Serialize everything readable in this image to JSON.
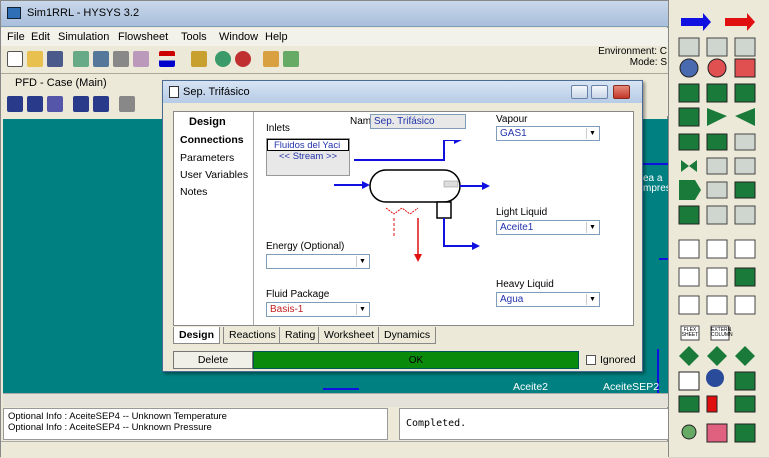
{
  "app": {
    "title": "Sim1RRL - HYSYS 3.2",
    "menu": [
      "File",
      "Edit",
      "Simulation",
      "Flowsheet",
      "Tools",
      "Window",
      "Help"
    ],
    "environment_text": "Environment: C",
    "mode_text": "Mode: S"
  },
  "pfd": {
    "title": "PFD - Case (Main)",
    "canvas_labels": [
      "ea a",
      "mpres",
      "Aceite2",
      "AceiteSEP2"
    ]
  },
  "dialog": {
    "title": "Sep. Trifásico",
    "nav_header": "Design",
    "nav_items": [
      "Connections",
      "Parameters",
      "User Variables",
      "Notes"
    ],
    "name_label": "Name",
    "name_value": "Sep. Trifásico",
    "inlets_label": "Inlets",
    "inlets": [
      "Fluidos del Yaci",
      "<< Stream >>"
    ],
    "vapour_label": "Vapour",
    "vapour_value": "GAS1",
    "light_liquid_label": "Light Liquid",
    "light_liquid_value": "Aceite1",
    "heavy_liquid_label": "Heavy Liquid",
    "heavy_liquid_value": "Agua",
    "energy_label": "Energy (Optional)",
    "energy_value": "",
    "fluid_pkg_label": "Fluid Package",
    "fluid_pkg_value": "Basis-1",
    "tabs": [
      "Design",
      "Reactions",
      "Rating",
      "Worksheet",
      "Dynamics"
    ],
    "delete_label": "Delete",
    "status": "OK",
    "ignored_label": "Ignored"
  },
  "info": {
    "lines": [
      "Optional Info : AceiteSEP4 -- Unknown Temperature",
      "Optional Info : AceiteSEP4 -- Unknown Pressure"
    ],
    "status_text": "Completed."
  },
  "palette": {
    "items": [
      "stream-blue-icon",
      "stream-red-icon",
      "heater-icon",
      "pump-icon",
      "vessel-icon",
      "mixer-icon",
      "tank-icon",
      "column-icon",
      "valve-icon",
      "tee-icon",
      "exchanger-icon",
      "flex-sheet-label",
      "sub-flowsheet-label"
    ],
    "labels": [
      "FLEX SHEET",
      "EXTERN COLUMN"
    ]
  },
  "colors": {
    "teal": "#008080",
    "ok_green": "#0a8a0a",
    "stream_blue": "#1010e0",
    "energy_red": "#e01010"
  }
}
